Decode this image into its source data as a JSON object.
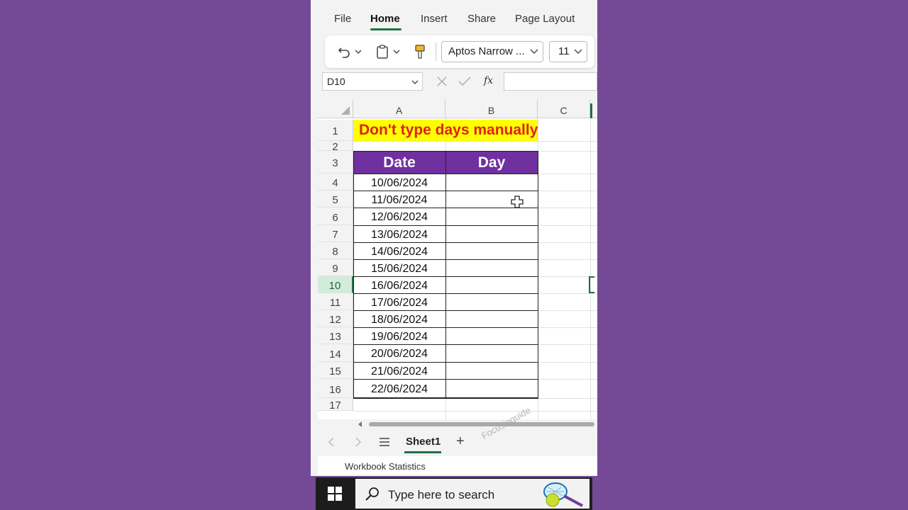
{
  "menu": {
    "tabs": [
      {
        "label": "File"
      },
      {
        "label": "Home"
      },
      {
        "label": "Insert"
      },
      {
        "label": "Share"
      },
      {
        "label": "Page Layout"
      }
    ],
    "active_tab": "Home"
  },
  "ribbon": {
    "font_name": "Aptos Narrow ...",
    "font_size": "11",
    "icons": [
      "undo-icon",
      "clipboard-icon",
      "format-painter-icon"
    ]
  },
  "formula_bar": {
    "name_box": "D10",
    "fx_label": "fx",
    "content": ""
  },
  "sheet": {
    "columns": [
      "A",
      "B",
      "C"
    ],
    "rows": [
      "1",
      "2",
      "3",
      "4",
      "5",
      "6",
      "7",
      "8",
      "9",
      "10",
      "11",
      "12",
      "13",
      "14",
      "15",
      "16",
      "17"
    ],
    "selected_row": "10",
    "title": "Don't type days manually",
    "headers": {
      "date": "Date",
      "day": "Day"
    },
    "dates": [
      "10/06/2024",
      "11/06/2024",
      "12/06/2024",
      "13/06/2024",
      "14/06/2024",
      "15/06/2024",
      "16/06/2024",
      "17/06/2024",
      "18/06/2024",
      "19/06/2024",
      "20/06/2024",
      "21/06/2024",
      "22/06/2024"
    ],
    "watermark": "Focusinguide"
  },
  "sheet_tabs": {
    "active": "Sheet1",
    "add_label": "+"
  },
  "status_bar": {
    "text": "Workbook Statistics"
  },
  "taskbar": {
    "search_placeholder": "Type here to search"
  },
  "colors": {
    "page_background": "#744a96",
    "title_fill": "#ffff00",
    "title_text": "#e0201c",
    "header_fill": "#7030a0",
    "accent_green": "#1e7145"
  }
}
